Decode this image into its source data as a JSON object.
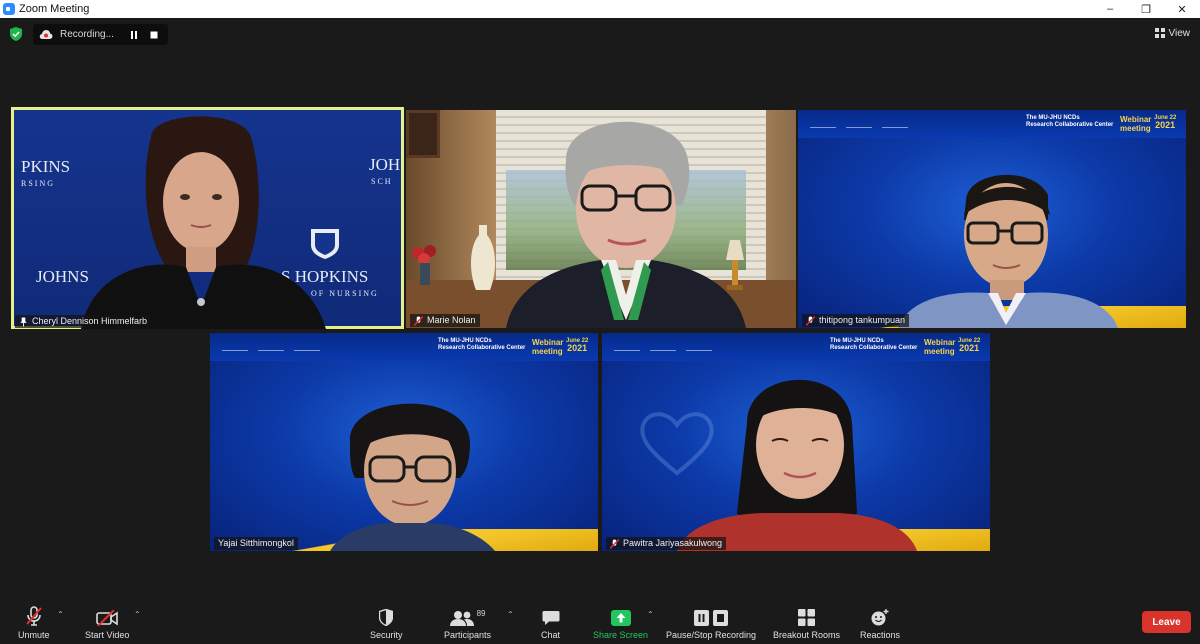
{
  "window": {
    "title": "Zoom Meeting",
    "controls": [
      "–",
      "❐",
      "✕"
    ]
  },
  "topbar": {
    "recording_label": "Recording...",
    "view_label": "View"
  },
  "participants": [
    {
      "name": "Cheryl Dennison Himmelfarb",
      "muted": false,
      "pinned": true,
      "active_speaker": true
    },
    {
      "name": "Marie Nolan",
      "muted": true
    },
    {
      "name": "thitipong tankumpuan",
      "muted": true
    },
    {
      "name": "Yajai Sitthimongkol",
      "muted": false
    },
    {
      "name": "Pawitra Jariyasakulwong",
      "muted": true
    }
  ],
  "backgrounds": {
    "hopkins_lines": [
      "PKINS",
      "RSING",
      "JOHNS",
      "S HOPKINS",
      "OF NURSING",
      "JOH",
      "SCH"
    ],
    "webinar": {
      "title_line1": "The MU-JHU NCDs",
      "title_line2": "Research Collaborative Center",
      "webinar_line1": "Webinar",
      "webinar_line2": "meeting",
      "date_line1": "June 22",
      "date_line2": "2021"
    }
  },
  "toolbar": {
    "unmute": "Unmute",
    "start_video": "Start Video",
    "security": "Security",
    "participants": "Participants",
    "participants_count": "89",
    "chat": "Chat",
    "share_screen": "Share Screen",
    "recording": "Pause/Stop Recording",
    "breakout": "Breakout Rooms",
    "reactions": "Reactions",
    "leave": "Leave"
  },
  "colors": {
    "share_green": "#22c55e",
    "leave_red": "#d9332b",
    "active_border": "#e6f08a",
    "zoom_blue": "#2d8cff"
  }
}
